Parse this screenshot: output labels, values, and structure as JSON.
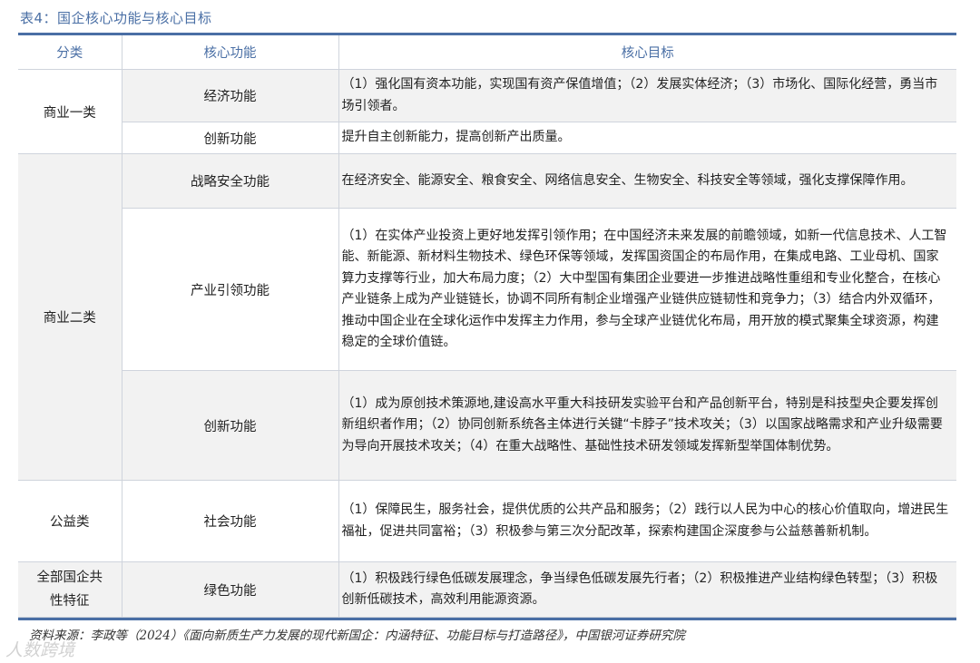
{
  "caption": "表4：国企核心功能与核心目标",
  "headers": {
    "category": "分类",
    "function": "核心功能",
    "goal": "核心目标"
  },
  "rows": [
    {
      "category": "商业一类",
      "function": "经济功能",
      "goal": "（1）强化国有资本功能，实现国有资产保值增值；（2）发展实体经济；（3）市场化、国际化经营，勇当市场引领者。"
    },
    {
      "function": "创新功能",
      "goal": "提升自主创新能力，提高创新产出质量。"
    },
    {
      "category": "商业二类",
      "function": "战略安全功能",
      "goal": "在经济安全、能源安全、粮食安全、网络信息安全、生物安全、科技安全等领域，强化支撑保障作用。"
    },
    {
      "function": "产业引领功能",
      "goal": "（1）在实体产业投资上更好地发挥引领作用；在中国经济未来发展的前瞻领域，如新一代信息技术、人工智能、新能源、新材料生物技术、绿色环保等领域，发挥国资国企的布局作用，在集成电路、工业母机、国家算力支撑等行业，加大布局力度；（2）大中型国有集团企业要进一步推进战略性重组和专业化整合，在核心产业链条上成为产业链链长，协调不同所有制企业增强产业链供应链韧性和竞争力；（3）结合内外双循环，推动中国企业在全球化运作中发挥主力作用，参与全球产业链优化布局，用开放的模式聚集全球资源，构建稳定的全球价值链。"
    },
    {
      "function": "创新功能",
      "goal": "（1）成为原创技术策源地,建设高水平重大科技研发实验平台和产品创新平台，特别是科技型央企要发挥创新组织者作用；（2）协同创新系统各主体进行关键“卡脖子”技术攻关；（3）以国家战略需求和产业升级需要为导向开展技术攻关；（4）在重大战略性、基础性技术研发领域发挥新型举国体制优势。"
    },
    {
      "category": "公益类",
      "function": "社会功能",
      "goal": "（1）保障民生，服务社会，提供优质的公共产品和服务；（2）践行以人民为中心的核心价值取向，增进民生福祉，促进共同富裕；（3）积极参与第三次分配改革，探索构建国企深度参与公益慈善新机制。"
    },
    {
      "category": "全部国企共性特征",
      "function": "绿色功能",
      "goal": "（1）积极践行绿色低碳发展理念，争当绿色低碳发展先行者；（2）积极推进产业结构绿色转型；（3）积极创新低碳技术，高效利用能源资源。"
    }
  ],
  "source": "资料来源：李政等（2024）《面向新质生产力发展的现代新国企：内涵特征、功能目标与打造路径》，中国银河证券研究院",
  "watermark": "人数跨境",
  "colors": {
    "accent": "#4a6fa5",
    "shade": "#f2f2f2",
    "border": "#cfd4dc"
  }
}
